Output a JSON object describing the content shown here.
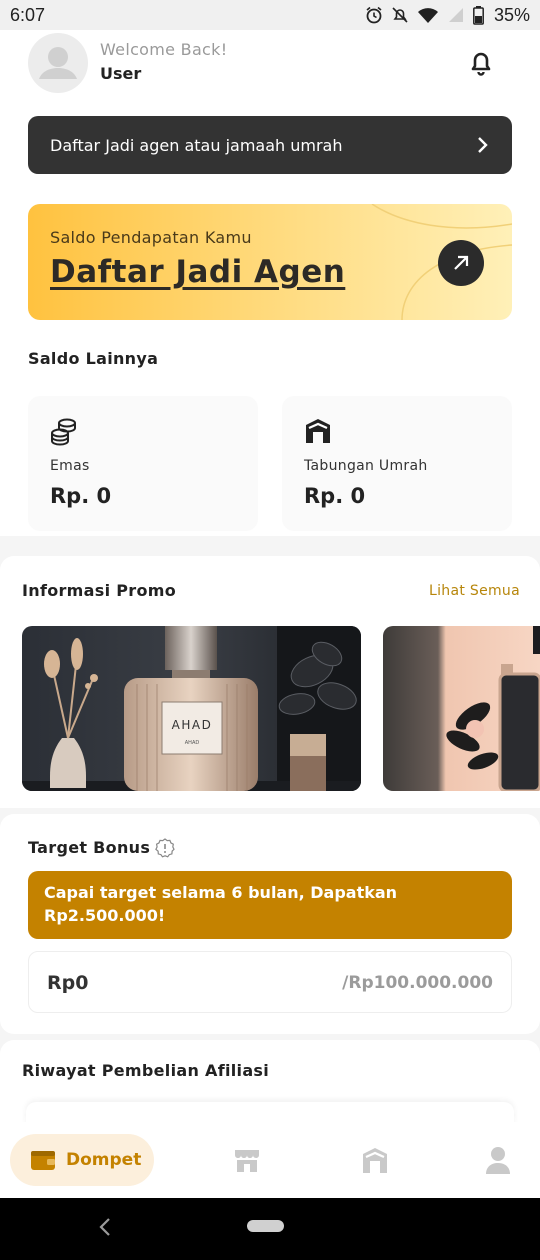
{
  "status_bar": {
    "time": "6:07",
    "battery_percent": "35%"
  },
  "header": {
    "welcome": "Welcome Back!",
    "user_name": "User"
  },
  "agent_banner": {
    "label": "Daftar Jadi agen atau jamaah umrah"
  },
  "earnings_card": {
    "subtitle": "Saldo Pendapatan Kamu",
    "title": "Daftar Jadi Agen"
  },
  "other_balance": {
    "title": "Saldo Lainnya",
    "items": [
      {
        "label": "Emas",
        "value": "Rp. 0",
        "icon": "coins-icon"
      },
      {
        "label": "Tabungan Umrah",
        "value": "Rp. 0",
        "icon": "kaaba-icon"
      }
    ]
  },
  "promo": {
    "title": "Informasi Promo",
    "see_all": "Lihat Semua",
    "images": [
      {
        "label": "AHAD",
        "sublabel": "AHAD"
      },
      {
        "label": ""
      }
    ]
  },
  "target_bonus": {
    "title": "Target Bonus",
    "banner": "Capai target selama 6 bulan, Dapatkan Rp2.500.000!",
    "current": "Rp0",
    "target": "/Rp100.000.000"
  },
  "affiliate_history": {
    "title": "Riwayat Pembelian Afiliasi"
  },
  "bottom_nav": {
    "active_label": "Dompet",
    "items": [
      "wallet-icon",
      "shop-icon",
      "kaaba-icon",
      "profile-icon"
    ]
  },
  "colors": {
    "accent": "#c48200",
    "dark": "#333333",
    "gold_start": "#ffc23f",
    "gold_end": "#fff0b8"
  }
}
